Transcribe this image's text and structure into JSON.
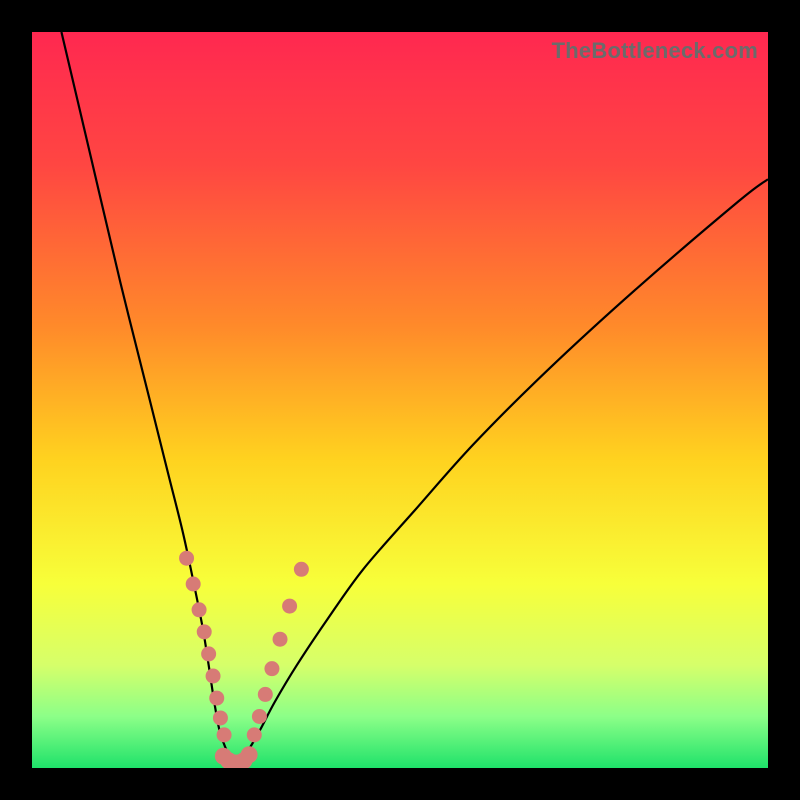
{
  "watermark": "TheBottleneck.com",
  "colors": {
    "frame": "#000000",
    "gradient_stops": [
      {
        "offset": 0.0,
        "color": "#ff2850"
      },
      {
        "offset": 0.18,
        "color": "#ff4642"
      },
      {
        "offset": 0.4,
        "color": "#ff8a2a"
      },
      {
        "offset": 0.58,
        "color": "#ffd21f"
      },
      {
        "offset": 0.75,
        "color": "#f7ff3a"
      },
      {
        "offset": 0.86,
        "color": "#d6ff6a"
      },
      {
        "offset": 0.93,
        "color": "#8cff88"
      },
      {
        "offset": 1.0,
        "color": "#1fe26a"
      }
    ],
    "curve": "#000000",
    "dot": "#d77b76"
  },
  "chart_data": {
    "type": "line",
    "title": "",
    "xlabel": "",
    "ylabel": "",
    "xlim": [
      0,
      100
    ],
    "ylim": [
      0,
      100
    ],
    "grid": false,
    "legend": false,
    "series": [
      {
        "name": "left-curve",
        "x": [
          4,
          8,
          12,
          16,
          18.5,
          20.5,
          22,
          23.2,
          24,
          24.6,
          25.1,
          25.5,
          26,
          26.5,
          27.2,
          28.1
        ],
        "y": [
          100,
          83,
          66,
          50,
          40,
          32,
          25,
          19,
          14,
          10,
          7,
          5,
          3.5,
          2.3,
          1.4,
          0.8
        ]
      },
      {
        "name": "right-curve",
        "x": [
          28.1,
          29.5,
          31,
          33,
          36,
          40,
          45,
          52,
          60,
          70,
          82,
          96,
          100
        ],
        "y": [
          0.8,
          2.6,
          5.2,
          9,
          14,
          20,
          27,
          35,
          44,
          54,
          65,
          77,
          80
        ]
      },
      {
        "name": "valley-floor",
        "x": [
          26.0,
          26.8,
          27.6,
          28.4,
          29.2
        ],
        "y": [
          1.2,
          0.7,
          0.6,
          0.7,
          1.8
        ]
      }
    ],
    "chart_dots": {
      "left_cluster": [
        {
          "x": 21.0,
          "y": 28.5
        },
        {
          "x": 21.9,
          "y": 25.0
        },
        {
          "x": 22.7,
          "y": 21.5
        },
        {
          "x": 23.4,
          "y": 18.5
        },
        {
          "x": 24.0,
          "y": 15.5
        },
        {
          "x": 24.6,
          "y": 12.5
        },
        {
          "x": 25.1,
          "y": 9.5
        },
        {
          "x": 25.6,
          "y": 6.8
        },
        {
          "x": 26.1,
          "y": 4.5
        }
      ],
      "valley_cluster": [
        {
          "x": 26.0,
          "y": 1.6
        },
        {
          "x": 26.7,
          "y": 1.0
        },
        {
          "x": 27.4,
          "y": 0.7
        },
        {
          "x": 28.1,
          "y": 0.7
        },
        {
          "x": 28.8,
          "y": 1.0
        },
        {
          "x": 29.5,
          "y": 1.8
        }
      ],
      "right_cluster": [
        {
          "x": 30.2,
          "y": 4.5
        },
        {
          "x": 30.9,
          "y": 7.0
        },
        {
          "x": 31.7,
          "y": 10.0
        },
        {
          "x": 32.6,
          "y": 13.5
        },
        {
          "x": 33.7,
          "y": 17.5
        },
        {
          "x": 35.0,
          "y": 22.0
        },
        {
          "x": 36.6,
          "y": 27.0
        }
      ]
    }
  }
}
